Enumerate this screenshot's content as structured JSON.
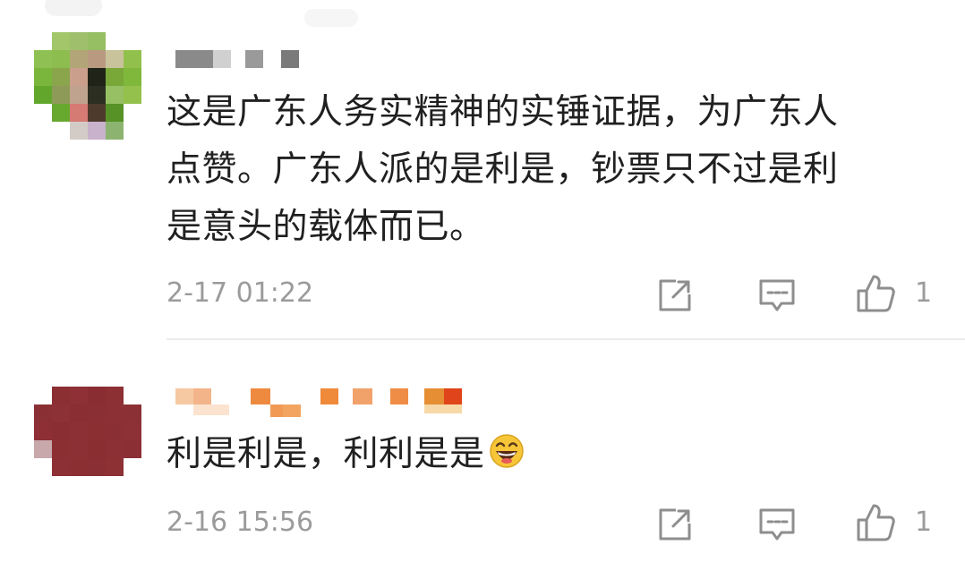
{
  "comments": [
    {
      "lines": [
        "这是广东人务实精神的实锤证据，为广东人",
        "点赞。广东人派的是利是，钞票只不过是利",
        "是意头的载体而已。"
      ],
      "timestamp": "2-17 01:22",
      "like_count": "1",
      "emoji": null
    },
    {
      "lines": [
        "利是利是，利利是是"
      ],
      "timestamp": "2-16 15:56",
      "like_count": "1",
      "emoji": "grinning-face"
    }
  ],
  "colors": {
    "text": "#202020",
    "meta": "#9b9b9b",
    "divider": "#ececec",
    "icon": "#8e8e8e"
  },
  "icons": [
    "share-icon",
    "reply-comment-icon",
    "thumbs-up-icon"
  ]
}
